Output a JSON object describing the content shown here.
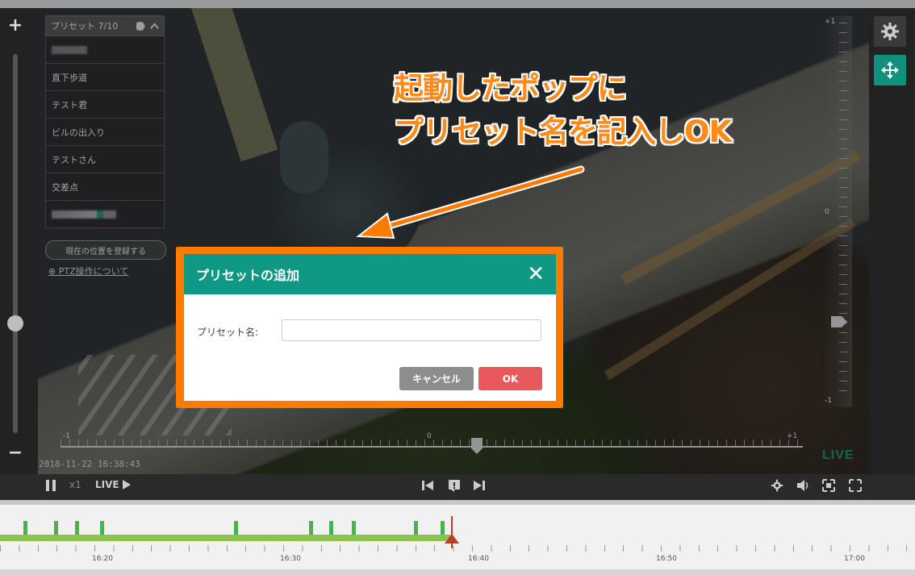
{
  "preset_panel": {
    "title": "プリセット 7/10",
    "items": [
      "直下歩道",
      "テスト君",
      "ビルの出入り",
      "テストさん",
      "交差点"
    ],
    "register_button": "現在の位置を登録する",
    "ptz_link": "PTZ操作について"
  },
  "video": {
    "timestamp": "2018-11-22 16:38:43",
    "live_badge": "LIVE"
  },
  "tilt_scale": {
    "top": "+1",
    "middle": "0",
    "bottom": "-1"
  },
  "pan_scale": {
    "left": "-1",
    "middle": "0",
    "right": "+1"
  },
  "controls": {
    "speed": "x1",
    "live": "LIVE"
  },
  "timeline": {
    "labels": [
      "16:20",
      "16:30",
      "16:40",
      "16:50",
      "17:00"
    ]
  },
  "annotation": {
    "line1": "起動したポップに",
    "line2": "プリセット名を記入しOK"
  },
  "dialog": {
    "title": "プリセットの追加",
    "field_label": "プリセット名:",
    "field_value": "",
    "cancel_label": "キャンセル",
    "ok_label": "OK"
  },
  "colors": {
    "accent": "#0f9884",
    "callout": "#ff8a1a",
    "ok_button": "#e8585c",
    "timeline_bar": "#8bc34a",
    "timeline_cursor": "#c0392b"
  }
}
